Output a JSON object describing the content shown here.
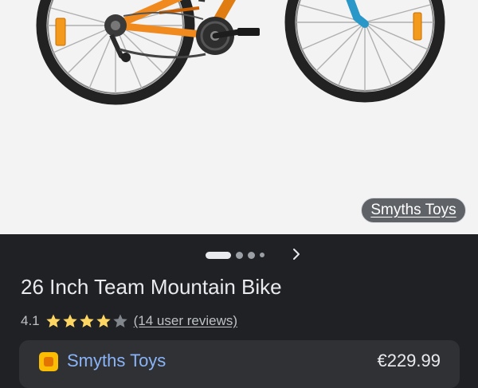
{
  "hero": {
    "image_icon": "bike-image",
    "source_chip": "Smyths Toys",
    "carousel_total_dots": 4,
    "carousel_active_index": 0
  },
  "product": {
    "title": "26 Inch Team Mountain Bike",
    "rating_value": "4.1",
    "rating_stars": 4.1,
    "rating_max": 5,
    "reviews": "(14 user reviews)"
  },
  "offer": {
    "store_name": "Smyths Toys",
    "price": "€229.99",
    "store_icon": "store-logo-icon"
  },
  "colors": {
    "frame_orange": "#f18a1e",
    "fork_blue": "#2a97c9",
    "star_gold": "#fdd663",
    "link_blue": "#8ab4f8",
    "dark_bg": "#202124"
  }
}
